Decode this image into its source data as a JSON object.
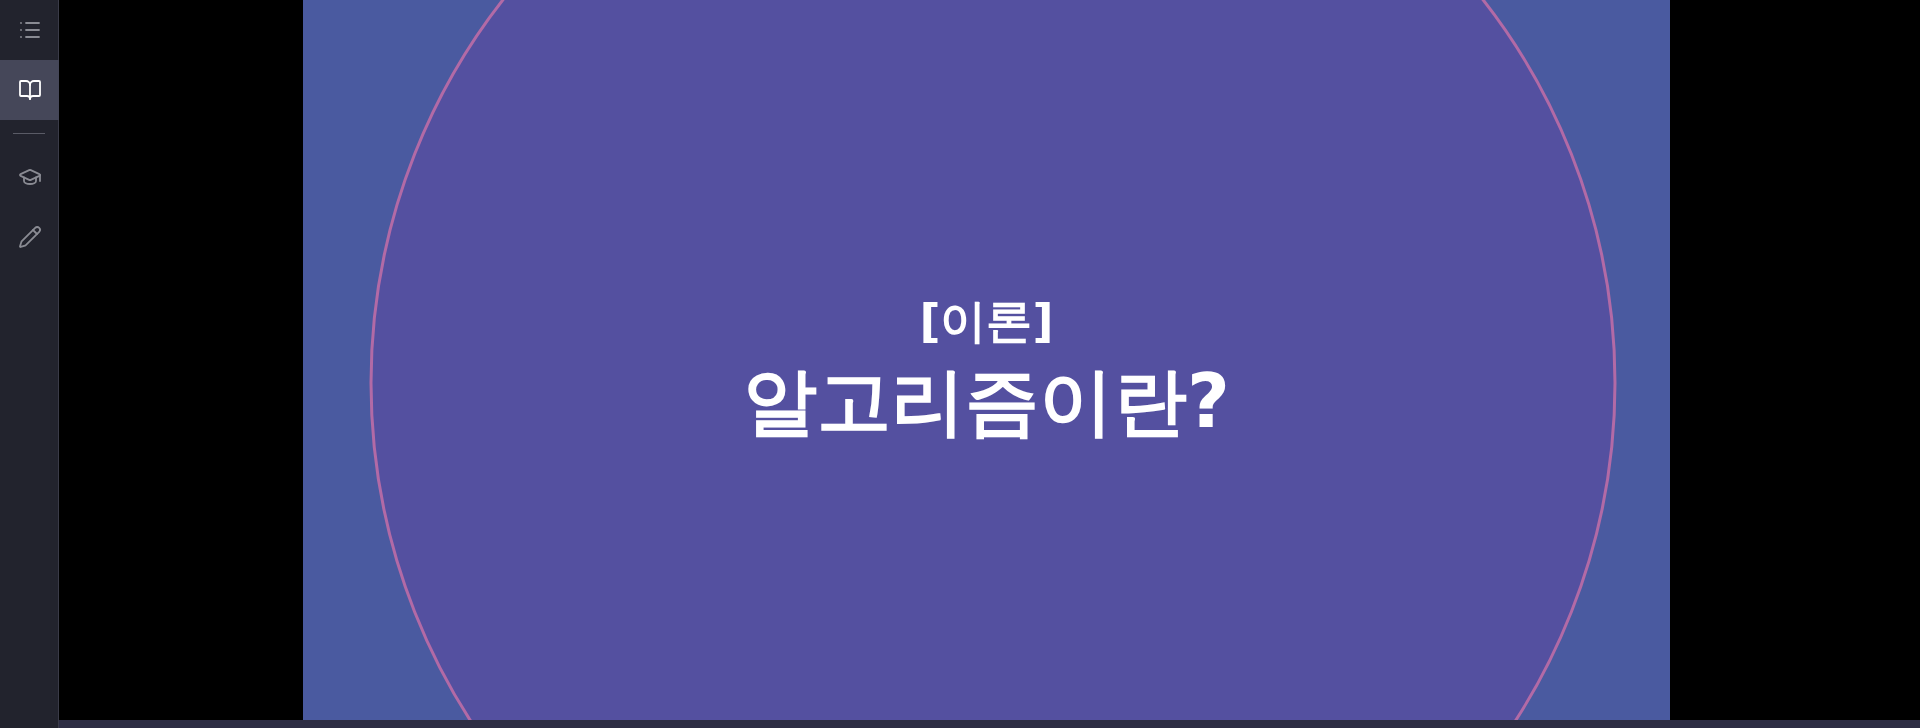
{
  "sidebar": {
    "top_items": [
      {
        "selected": false
      },
      {
        "selected": true
      }
    ],
    "bottom_items": [
      {
        "selected": false
      },
      {
        "selected": false
      }
    ]
  },
  "slide": {
    "subtitle": "[이론]",
    "title": "알고리즘이란?"
  }
}
